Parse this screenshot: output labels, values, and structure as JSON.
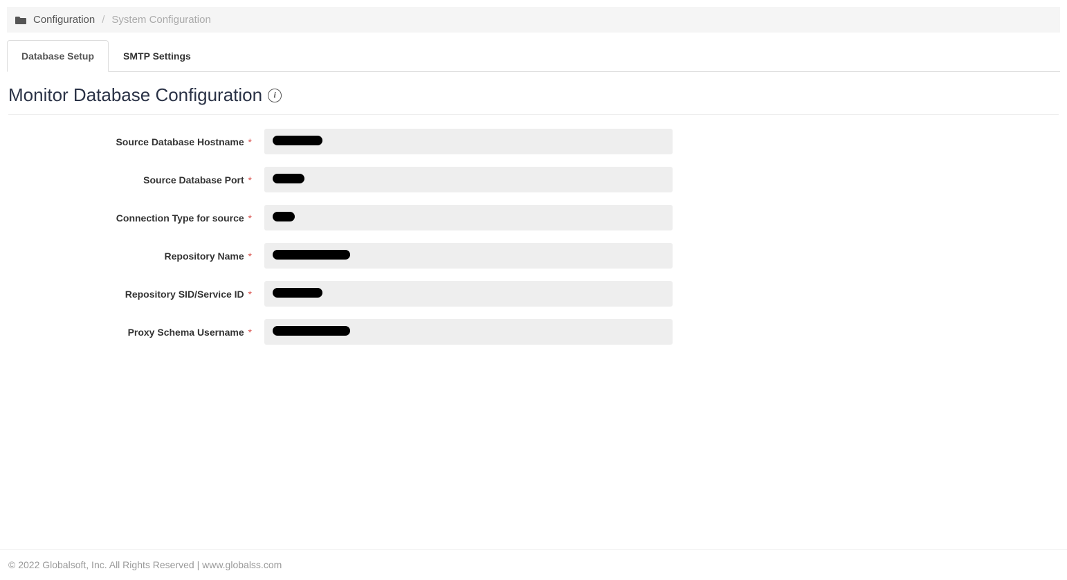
{
  "breadcrumb": {
    "root": "Configuration",
    "current": "System Configuration"
  },
  "tabs": [
    {
      "label": "Database Setup",
      "active": true
    },
    {
      "label": "SMTP Settings",
      "active": false
    }
  ],
  "page": {
    "title": "Monitor Database Configuration"
  },
  "form": {
    "fields": [
      {
        "label": "Source Database Hostname",
        "required": true,
        "redacted_width": 72
      },
      {
        "label": "Source Database Port",
        "required": true,
        "redacted_width": 46
      },
      {
        "label": "Connection Type for source",
        "required": true,
        "redacted_width": 32
      },
      {
        "label": "Repository Name",
        "required": true,
        "redacted_width": 112
      },
      {
        "label": "Repository SID/Service ID",
        "required": true,
        "redacted_width": 72
      },
      {
        "label": "Proxy Schema Username",
        "required": true,
        "redacted_width": 112
      }
    ]
  },
  "footer": {
    "copyright": "© 2022 Globalsoft, Inc. All Rights Reserved",
    "separator": " | ",
    "link": "www.globalss.com"
  }
}
